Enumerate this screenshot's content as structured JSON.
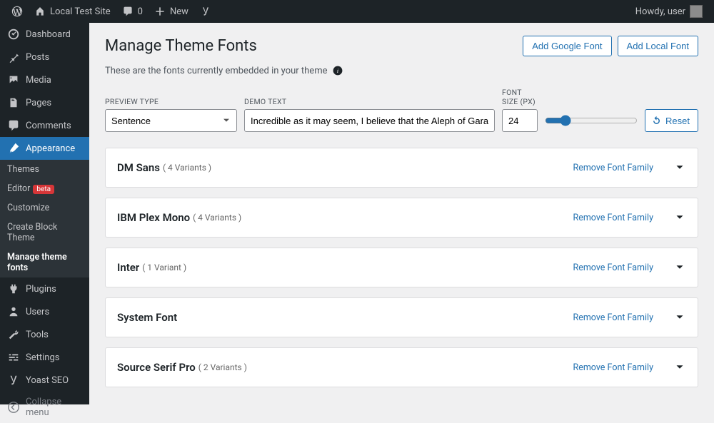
{
  "adminbar": {
    "site_name": "Local Test Site",
    "comments_count": "0",
    "new_label": "New",
    "greeting": "Howdy, user"
  },
  "sidebar": {
    "items": [
      {
        "label": "Dashboard"
      },
      {
        "label": "Posts"
      },
      {
        "label": "Media"
      },
      {
        "label": "Pages"
      },
      {
        "label": "Comments"
      },
      {
        "label": "Appearance"
      },
      {
        "label": "Plugins"
      },
      {
        "label": "Users"
      },
      {
        "label": "Tools"
      },
      {
        "label": "Settings"
      },
      {
        "label": "Yoast SEO"
      },
      {
        "label": "Collapse menu"
      }
    ],
    "submenu": [
      {
        "label": "Themes"
      },
      {
        "label": "Editor",
        "badge": "beta"
      },
      {
        "label": "Customize"
      },
      {
        "label": "Create Block Theme"
      },
      {
        "label": "Manage theme fonts"
      }
    ]
  },
  "page": {
    "title": "Manage Theme Fonts",
    "add_google": "Add Google Font",
    "add_local": "Add Local Font",
    "description": "These are the fonts currently embedded in your theme"
  },
  "controls": {
    "preview_type_label": "PREVIEW TYPE",
    "preview_type_value": "Sentence",
    "demo_text_label": "DEMO TEXT",
    "demo_text_value": "Incredible as it may seem, I believe that the Aleph of Garay Street was a false Ale",
    "font_size_label": "FONT SIZE (PX)",
    "font_size_value": "24",
    "reset_label": "Reset"
  },
  "fonts": [
    {
      "name": "DM Sans",
      "variants": "( 4 Variants )",
      "remove": "Remove Font Family"
    },
    {
      "name": "IBM Plex Mono",
      "variants": "( 4 Variants )",
      "remove": "Remove Font Family"
    },
    {
      "name": "Inter",
      "variants": "( 1 Variant )",
      "remove": "Remove Font Family"
    },
    {
      "name": "System Font",
      "variants": "",
      "remove": "Remove Font Family"
    },
    {
      "name": "Source Serif Pro",
      "variants": "( 2 Variants )",
      "remove": "Remove Font Family"
    }
  ]
}
